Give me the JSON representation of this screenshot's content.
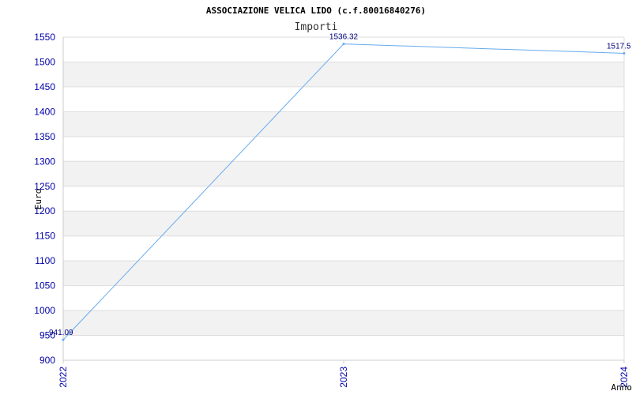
{
  "chart_data": {
    "type": "line",
    "title": "ASSOCIAZIONE VELICA LIDO (c.f.80016840276)",
    "subtitle": "Importi",
    "xlabel": "Anno",
    "ylabel": "Euro",
    "categories": [
      "2022",
      "2023",
      "2024"
    ],
    "values": [
      941.09,
      1536.32,
      1517.5
    ],
    "data_labels": [
      "941.09",
      "1536.32",
      "1517.5"
    ],
    "ylim": [
      900,
      1550
    ],
    "yticks": [
      "900",
      "950",
      "1000",
      "1050",
      "1100",
      "1150",
      "1200",
      "1250",
      "1300",
      "1350",
      "1400",
      "1450",
      "1500",
      "1550"
    ],
    "grid": true,
    "band_color": "#f2f2f2",
    "grid_color": "#dddddd",
    "line_color": "#66aaee",
    "tick_color": "#0000aa"
  }
}
